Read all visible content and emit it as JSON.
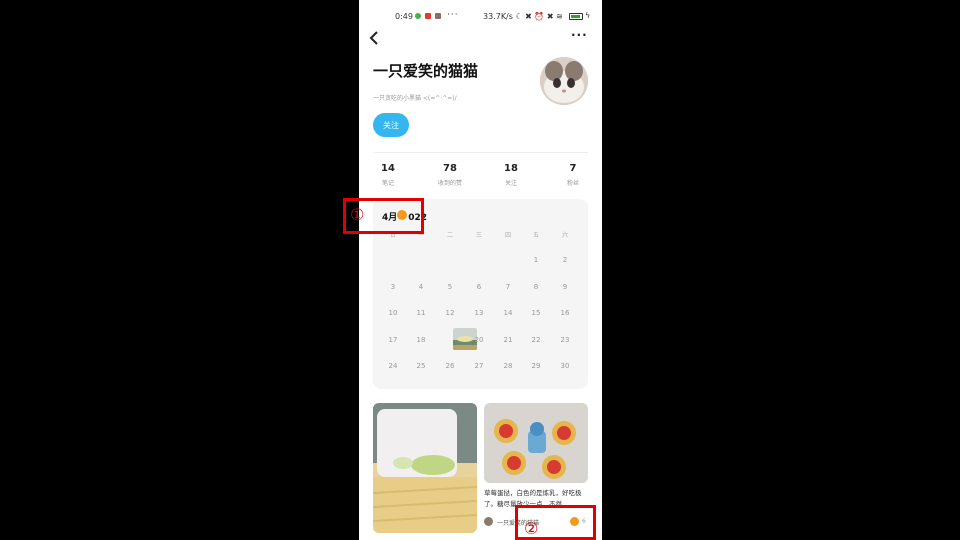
{
  "status_bar": {
    "time": "0:49",
    "more": "···",
    "right_text": "33.7K/s ☾ ✖ ⏰ ✖ ≋",
    "battery_level": 0.7,
    "charging": "ϟ"
  },
  "top_bar": {
    "back_icon": "chevron-left-icon",
    "back_glyph": "‹",
    "more_glyph": "···"
  },
  "profile": {
    "name": "一只爱笑的猫猫",
    "bio": "一只贪吃的小黑猫 <(=^·^=)/",
    "follow_label": "关注"
  },
  "stats": [
    {
      "value": "14",
      "label": "笔记"
    },
    {
      "value": "78",
      "label": "收到的赞"
    },
    {
      "value": "18",
      "label": "关注"
    },
    {
      "value": "7",
      "label": "粉丝"
    }
  ],
  "calendar": {
    "title_part1": "4月",
    "title_part2": "022",
    "weekdays": [
      "日",
      "一",
      "二",
      "三",
      "四",
      "五",
      "六"
    ],
    "weeks": [
      [
        "",
        "",
        "",
        "",
        "",
        "1",
        "2"
      ],
      [
        "3",
        "4",
        "5",
        "6",
        "7",
        "8",
        "9"
      ],
      [
        "10",
        "11",
        "12",
        "13",
        "14",
        "15",
        "16"
      ],
      [
        "17",
        "18",
        "",
        "20",
        "21",
        "22",
        "23"
      ],
      [
        "24",
        "25",
        "26",
        "27",
        "28",
        "29",
        "30"
      ]
    ]
  },
  "feed": {
    "card2": {
      "description": "草莓蛋挞，白色的是炼乳，好吃极了。糖尽量放少一点，不然...",
      "author": "一只爱笑的猫猫",
      "likes": "6"
    }
  },
  "annotations": {
    "label1": "①",
    "label2": "②",
    "color": "#e00000"
  },
  "colors": {
    "accent": "#35b6ee",
    "marker": "#f39a1c"
  }
}
